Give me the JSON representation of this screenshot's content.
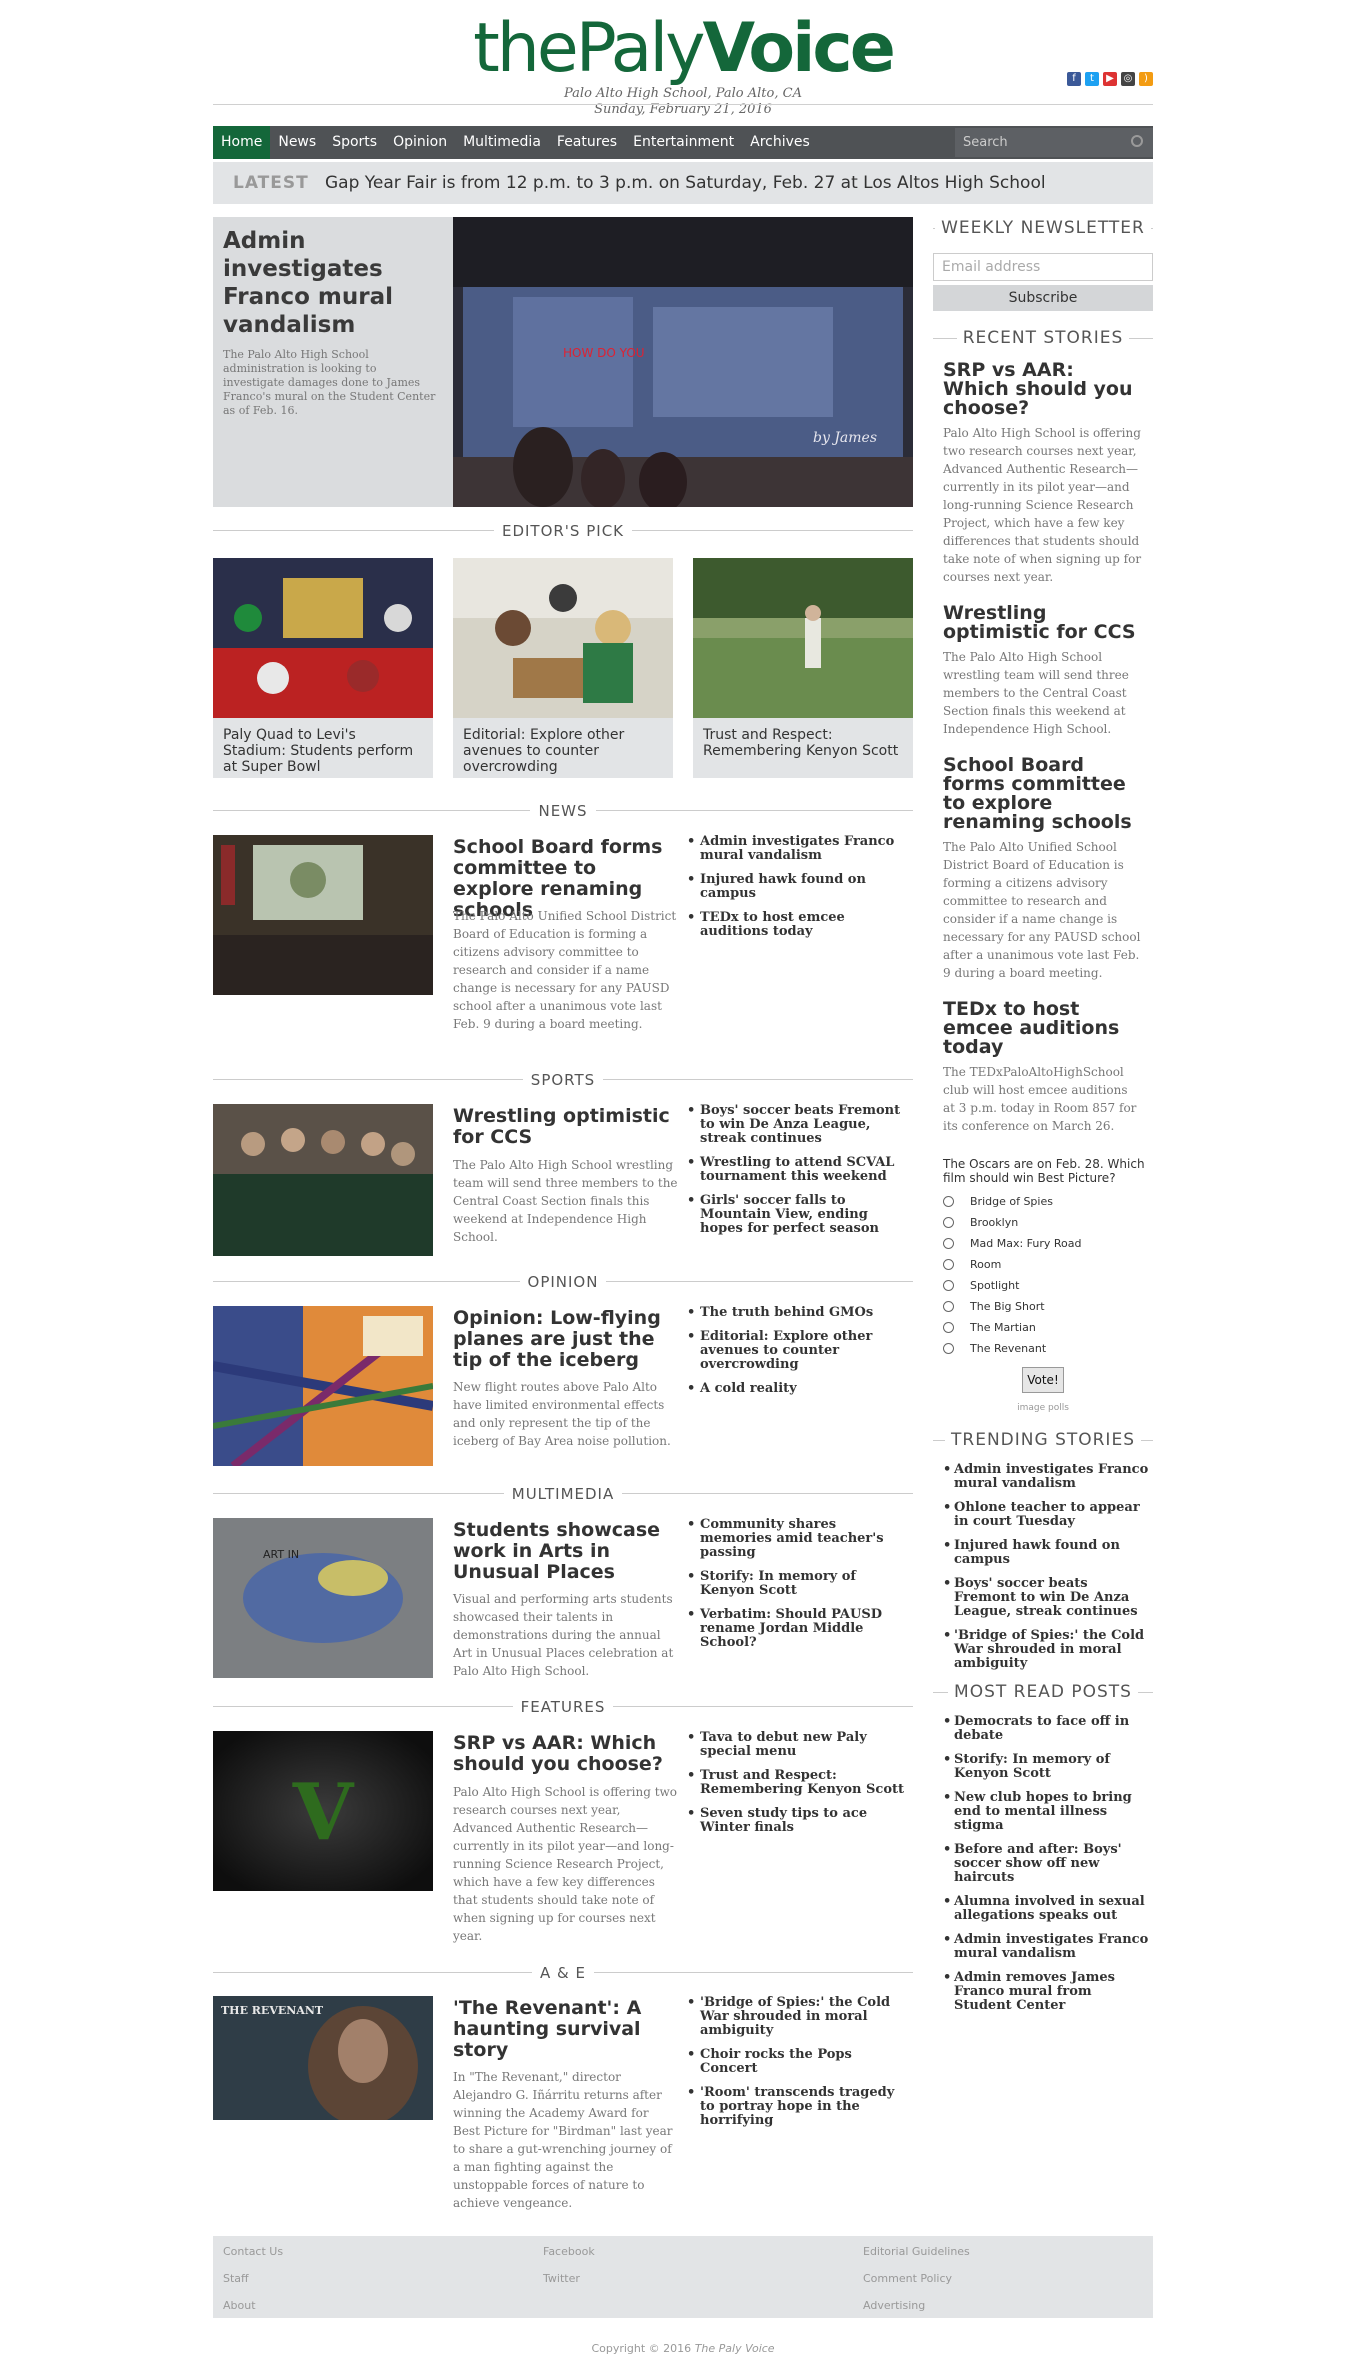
{
  "site": {
    "logo_thin": "thePaly",
    "logo_bold": "Voice",
    "location": "Palo Alto High School, Palo Alto, CA",
    "date": "Sunday, February 21, 2016"
  },
  "social": [
    "f",
    "t",
    "yt",
    "ig",
    "rss"
  ],
  "nav": {
    "items": [
      "Home",
      "News",
      "Sports",
      "Opinion",
      "Multimedia",
      "Features",
      "Entertainment",
      "Archives"
    ],
    "search_placeholder": "Search"
  },
  "latest": {
    "tag": "LATEST",
    "text": "Gap Year Fair is from 12 p.m. to 3 p.m. on Saturday, Feb. 27 at Los Altos High School"
  },
  "hero": {
    "title": "Admin investigates Franco mural vandalism",
    "dek": "The Palo Alto High School administration is looking to investigate damages done to James Franco's mural on the Student Center as of Feb. 16."
  },
  "editors_pick": {
    "label": "EDITOR'S PICK",
    "items": [
      "Paly Quad to Levi's Stadium: Students perform at Super Bowl",
      "Editorial: Explore other avenues to counter overcrowding",
      "Trust and Respect: Remembering Kenyon Scott"
    ]
  },
  "sections": {
    "news": {
      "label": "NEWS",
      "title": "School Board forms committee to explore renaming schools",
      "dek": "The Palo Alto Unified School District Board of Education is forming a citizens advisory committee to research and consider if a name change is necessary for any PAUSD school after a unanimous vote last Feb. 9 during a board meeting.",
      "links": [
        "Admin investigates Franco mural vandalism",
        "Injured hawk found on campus",
        "TEDx to host emcee auditions today"
      ]
    },
    "sports": {
      "label": "SPORTS",
      "title": "Wrestling optimistic for CCS",
      "dek": "The Palo Alto High School wrestling team will send three members to the Central Coast Section finals this weekend at Independence High School.",
      "links": [
        "Boys' soccer beats Fremont to win De Anza League, streak continues",
        "Wrestling to attend SCVAL tournament this weekend",
        "Girls' soccer falls to Mountain View, ending hopes for perfect season"
      ]
    },
    "opinion": {
      "label": "OPINION",
      "title": "Opinion: Low-flying planes are just the tip of the iceberg",
      "dek": "New flight routes above Palo Alto have limited environmental effects and only represent the tip of the iceberg of Bay Area noise pollution.",
      "links": [
        "The truth behind GMOs",
        "Editorial: Explore other avenues to counter overcrowding",
        "A cold reality"
      ]
    },
    "multimedia": {
      "label": "MULTIMEDIA",
      "title": "Students showcase work in Arts in Unusual Places",
      "dek": "Visual and performing arts students showcased their talents in demonstrations during the annual Art in Unusual Places celebration at Palo Alto High School.",
      "links": [
        "Community shares memories amid teacher's passing",
        "Storify: In memory of Kenyon Scott",
        "Verbatim: Should PAUSD rename Jordan Middle School?"
      ]
    },
    "features": {
      "label": "FEATURES",
      "title": "SRP vs AAR: Which should you choose?",
      "dek": "Palo Alto High School is offering two research courses next year, Advanced Authentic Research—currently in its pilot year—and long-running Science Research Project, which have a few key differences that students should take note of when signing up for courses next year.",
      "links": [
        "Tava to debut new Paly special menu",
        "Trust and Respect: Remembering Kenyon Scott",
        "Seven study tips to ace Winter finals"
      ]
    },
    "ae": {
      "label": "A & E",
      "title": "'The Revenant': A haunting survival story",
      "dek": "In \"The Revenant,\" director Alejandro G. Iñárritu returns after winning the Academy Award for Best Picture for \"Birdman\" last year to share a gut-wrenching journey of a man fighting against the unstoppable forces of nature to achieve vengeance.",
      "links": [
        "'Bridge of Spies:' the Cold War shrouded in moral ambiguity",
        "Choir rocks the Pops Concert",
        "'Room' transcends tragedy to portray hope in the horrifying"
      ],
      "thumb_text": "THE REVENANT"
    }
  },
  "sidebar": {
    "newsletter_label": "WEEKLY NEWSLETTER",
    "email_placeholder": "Email address",
    "subscribe_label": "Subscribe",
    "recent_label": "RECENT STORIES",
    "recent": [
      {
        "title": "SRP vs AAR: Which should you choose?",
        "dek": "Palo Alto High School is offering two research courses next year, Advanced Authentic Research—currently in its pilot year—and long-running Science Research Project, which have a few key differences that students should take note of when signing up for courses next year."
      },
      {
        "title": "Wrestling optimistic for CCS",
        "dek": "The Palo Alto High School wrestling team will send three members to the Central Coast Section finals this weekend at Independence High School."
      },
      {
        "title": "School Board forms committee to explore renaming schools",
        "dek": "The Palo Alto Unified School District Board of Education is forming a citizens advisory committee to research and consider if a name change is necessary for any PAUSD school after a unanimous vote last Feb. 9 during a board meeting."
      },
      {
        "title": "TEDx to host emcee auditions today",
        "dek": "The TEDxPaloAltoHighSchool club will host emcee auditions at 3 p.m. today in Room 857 for its conference on March 26."
      }
    ],
    "poll": {
      "question": "The Oscars are on Feb. 28. Which film should win Best Picture?",
      "options": [
        "Bridge of Spies",
        "Brooklyn",
        "Mad Max: Fury Road",
        "Room",
        "Spotlight",
        "The Big Short",
        "The Martian",
        "The Revenant"
      ],
      "vote_label": "Vote!",
      "credit": "image polls"
    },
    "trending_label": "TRENDING STORIES",
    "trending": [
      "Admin investigates Franco mural vandalism",
      "Ohlone teacher to appear in court Tuesday",
      "Injured hawk found on campus",
      "Boys' soccer beats Fremont to win De Anza League, streak continues",
      "'Bridge of Spies:' the Cold War shrouded in moral ambiguity"
    ],
    "mostread_label": "MOST READ POSTS",
    "mostread": [
      "Democrats to face off in debate",
      "Storify: In memory of Kenyon Scott",
      "New club hopes to bring end to mental illness stigma",
      "Before and after: Boys' soccer show off new haircuts",
      "Alumna involved in sexual allegations speaks out",
      "Admin investigates Franco mural vandalism",
      "Admin removes James Franco mural from Student Center"
    ]
  },
  "footer": {
    "col1": [
      "Contact Us",
      "Staff",
      "About"
    ],
    "col2": [
      "Facebook",
      "Twitter"
    ],
    "col3": [
      "Editorial Guidelines",
      "Comment Policy",
      "Advertising"
    ],
    "copyright": "Copyright © 2016",
    "copyright_brand": "The Paly Voice"
  },
  "colors": {
    "brand": "#14673a",
    "nav": "#4f5255",
    "panel": "#e2e4e6"
  }
}
